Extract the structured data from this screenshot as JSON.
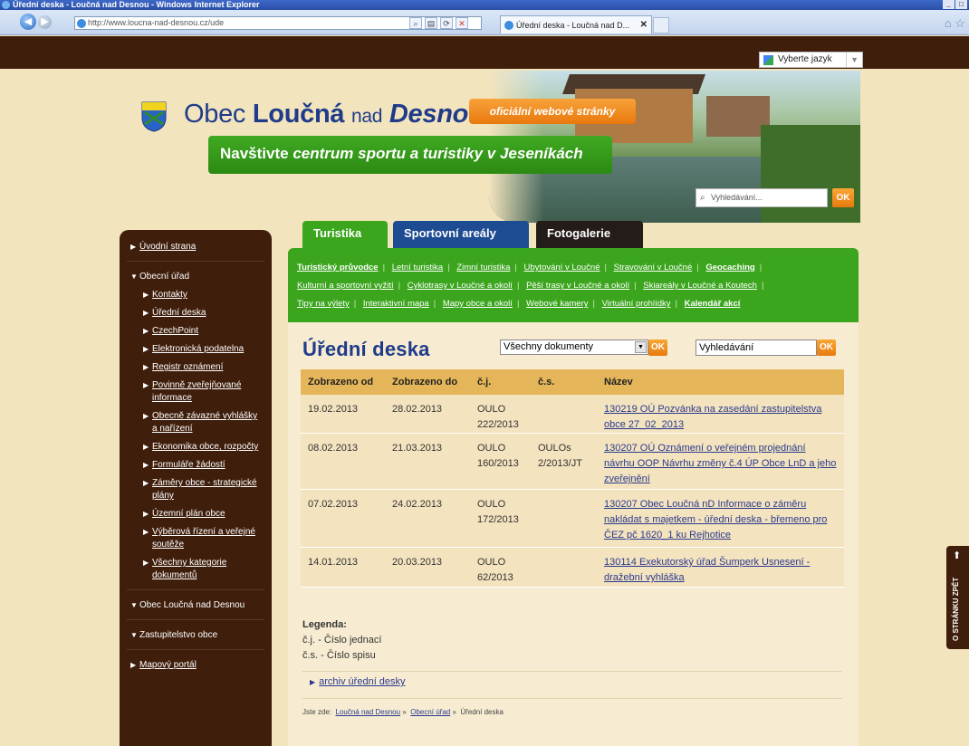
{
  "browser": {
    "window_title": "Úřední deska - Loučná nad Desnou - Windows Internet Explorer",
    "address": "http://www.loucna-nad-desnou.cz/ude",
    "tab_title": "Úřední deska - Loučná nad D...",
    "window_buttons": [
      "_",
      "□"
    ]
  },
  "site": {
    "language_selector": "Vyberte jazyk",
    "logo_prefix": "Obec",
    "logo_name_bold": "Loučná",
    "logo_nad": "nad",
    "logo_name_italic": "Desnou",
    "badge": "oficiální webové stránky",
    "banner_prefix": "Navštivte",
    "banner_italic": "centrum sportu a turistiky v Jeseníkách",
    "search_placeholder": "Vyhledávání...",
    "ok_label": "OK"
  },
  "sidebar": {
    "items": [
      {
        "label": "Úvodní strana"
      },
      {
        "label": "Obecní úřad"
      },
      {
        "label": "Kontakty"
      },
      {
        "label": "Úřední deska"
      },
      {
        "label": "CzechPoint"
      },
      {
        "label": "Elektronická podatelna"
      },
      {
        "label": "Registr oznámení"
      },
      {
        "label": "Povinně zveřejňované informace"
      },
      {
        "label": "Obecně závazné vyhlášky a nařízení"
      },
      {
        "label": "Ekonomika obce, rozpočty"
      },
      {
        "label": "Formuláře žádostí"
      },
      {
        "label": "Záměry obce - strategické plány"
      },
      {
        "label": "Územní plán obce"
      },
      {
        "label": "Výběrová řízení a veřejné soutěže"
      },
      {
        "label": "Všechny kategorie dokumentů"
      },
      {
        "label": "Obec Loučná nad Desnou"
      },
      {
        "label": "Zastupitelstvo obce"
      },
      {
        "label": "Mapový portál"
      }
    ]
  },
  "tabs": [
    "Turistika",
    "Sportovní areály",
    "Fotogalerie"
  ],
  "submenu": {
    "row1": [
      "Turistický průvodce",
      "Letní turistika",
      "Zimní turistika",
      "Ubytování v Loučné",
      "Stravování v Loučné",
      "Geocaching"
    ],
    "row2": [
      "Kulturní a sportovní vyžití",
      "Cyklotrasy v Loučné a okolí",
      "Pěší trasy v Loučné a okolí",
      "Skiareály v Loučné a Koutech"
    ],
    "row3": [
      "Tipy na výlety",
      "Interaktivní mapa",
      "Mapy obce a okolí",
      "Webové kamery",
      "Virtuální prohlídky",
      "Kalendář akcí"
    ]
  },
  "main": {
    "title": "Úřední deska",
    "filter_selected": "Všechny dokumenty",
    "search_value": "Vyhledávání",
    "ok_label": "OK",
    "columns": [
      "Zobrazeno od",
      "Zobrazeno do",
      "č.j.",
      "č.s.",
      "Název"
    ],
    "rows": [
      {
        "od": "19.02.2013",
        "do": "28.02.2013",
        "cj": "OULO 222/2013",
        "cs": "",
        "nazev": "130219 OÚ Pozvánka na zasedání zastupitelstva obce 27_02_2013"
      },
      {
        "od": "08.02.2013",
        "do": "21.03.2013",
        "cj": "OULO 160/2013",
        "cs": "OULOs 2/2013/JT",
        "nazev": "130207 OÚ Oznámení o veřejném projednání návrhu OOP Návrhu změny č.4 ÚP Obce LnD a jeho zveřejnění"
      },
      {
        "od": "07.02.2013",
        "do": "24.02.2013",
        "cj": "OULO 172/2013",
        "cs": "",
        "nazev": "130207 Obec Loučná nD Informace o záměru nakládat s majetkem - úřední deska - břemeno pro ČEZ pč 1620_1 ku Rejhotice"
      },
      {
        "od": "14.01.2013",
        "do": "20.03.2013",
        "cj": "OULO 62/2013",
        "cs": "",
        "nazev": "130114 Exekutorský úřad Šumperk Usnesení - dražební vyhláška"
      }
    ],
    "legend_title": "Legenda:",
    "legend_cj": "č.j. - Číslo jednací",
    "legend_cs": "č.s. - Číslo spisu",
    "archive_link": "archiv úřední desky",
    "breadcrumb_prefix": "Jste zde:",
    "breadcrumb": [
      "Loučná nad Desnou",
      "Obecní úřad",
      "Úřední deska"
    ]
  },
  "back_tab": "O STRÁNKU ZPĚT"
}
